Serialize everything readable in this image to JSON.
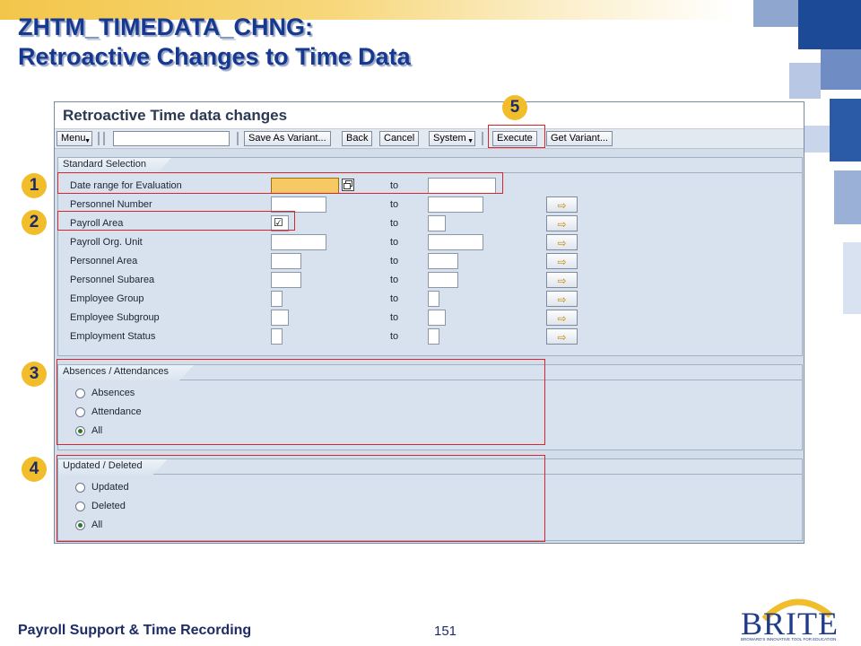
{
  "slide": {
    "title_line1": "ZHTM_TIMEDATA_CHNG:",
    "title_line2": "Retroactive Changes to Time Data",
    "footer": "Payroll Support & Time Recording",
    "page_number": "151",
    "logo_text": "BRITE",
    "logo_tagline": "BROWARD'S INNOVATIVE TOOL FOR EDUCATION"
  },
  "window": {
    "title": "Retroactive Time data changes"
  },
  "toolbar": {
    "menu": "Menu",
    "command_value": "",
    "save_as_variant": "Save As Variant...",
    "back": "Back",
    "cancel": "Cancel",
    "system": "System",
    "execute": "Execute",
    "get_variant": "Get Variant..."
  },
  "standard_selection": {
    "title": "Standard Selection",
    "to_label": "to",
    "rows": [
      {
        "label": "Date range for Evaluation"
      },
      {
        "label": "Personnel Number"
      },
      {
        "label": "Payroll Area",
        "checkbox": "☑"
      },
      {
        "label": "Payroll Org. Unit"
      },
      {
        "label": "Personnel Area"
      },
      {
        "label": "Personnel Subarea"
      },
      {
        "label": "Employee Group"
      },
      {
        "label": "Employee Subgroup"
      },
      {
        "label": "Employment Status"
      }
    ]
  },
  "absences": {
    "title": "Absences / Attendances",
    "options": [
      "Absences",
      "Attendance",
      "All"
    ],
    "selected": "All"
  },
  "updated": {
    "title": "Updated / Deleted",
    "options": [
      "Updated",
      "Deleted",
      "All"
    ],
    "selected": "All"
  },
  "callouts": [
    "1",
    "2",
    "3",
    "4",
    "5"
  ],
  "colors": {
    "title_blue": "#16388f",
    "badge_yellow": "#f1bd2a",
    "highlight_red": "#d8262c",
    "sap_panel": "#d3deea",
    "active_field": "#f6c965"
  },
  "icons": {
    "multiple_selection": "arrow-right-icon",
    "calendar": "multiple-value-icon"
  }
}
